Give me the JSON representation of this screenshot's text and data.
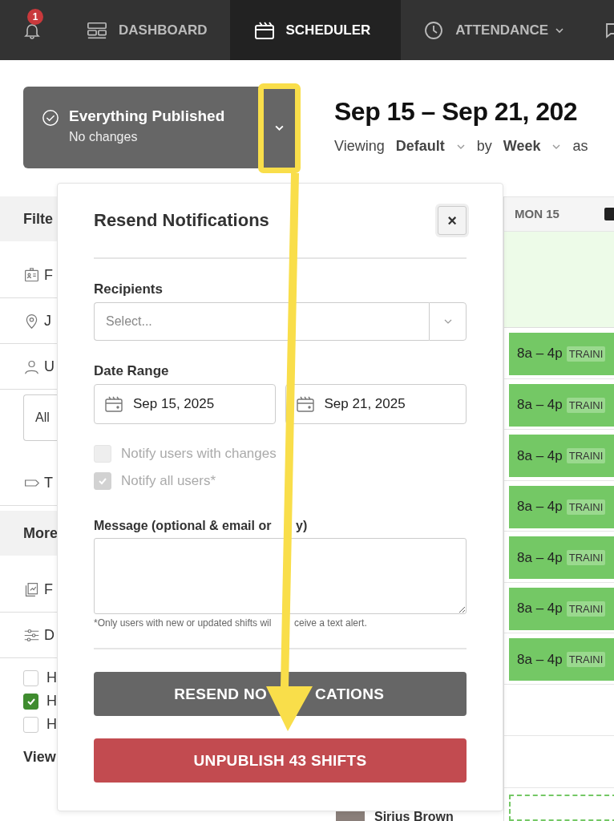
{
  "nav": {
    "badge": "1",
    "tabs": [
      {
        "kind": "dashboard",
        "label": "DASHBOARD",
        "selected": false,
        "dropdown": false
      },
      {
        "kind": "scheduler",
        "label": "SCHEDULER",
        "selected": true,
        "dropdown": false
      },
      {
        "kind": "attendance",
        "label": "ATTENDANCE",
        "selected": false,
        "dropdown": true
      }
    ]
  },
  "publish": {
    "title": "Everything Published",
    "subtitle": "No changes"
  },
  "header": {
    "date_range": "Sep 15 – Sep 21, 202",
    "view_controls": [
      {
        "label": "Viewing",
        "value": "Default"
      },
      {
        "label": "by",
        "value": "Week"
      }
    ],
    "trailing": "as"
  },
  "sidebar": {
    "sections": [
      {
        "title": "Filte",
        "items": [
          {
            "kind": "badge",
            "label": "F"
          },
          {
            "kind": "pin",
            "label": "J"
          },
          {
            "kind": "user",
            "label": "U"
          },
          {
            "kind": "select",
            "label": "All"
          },
          {
            "kind": "tag",
            "label": "T"
          }
        ]
      },
      {
        "title": "More",
        "items": [
          {
            "kind": "report",
            "label": "F"
          },
          {
            "kind": "sliders",
            "label": "D"
          }
        ]
      }
    ],
    "options": [
      {
        "label": "H",
        "checked": false
      },
      {
        "label": "H",
        "checked": true
      },
      {
        "label": "H",
        "checked": false
      }
    ],
    "footer_label": "View"
  },
  "calendar": {
    "day": "MON 15",
    "shifts": [
      {
        "time": "8a – 4p",
        "tag": "TRAINI"
      },
      {
        "time": "8a – 4p",
        "tag": "TRAINI"
      },
      {
        "time": "8a – 4p",
        "tag": "TRAINI"
      },
      {
        "time": "8a – 4p",
        "tag": "TRAINI"
      },
      {
        "time": "8a – 4p",
        "tag": "TRAINI"
      },
      {
        "time": "8a – 4p",
        "tag": "TRAINI"
      },
      {
        "time": "8a – 4p",
        "tag": "TRAINI"
      }
    ]
  },
  "employee": {
    "name": "Sirius Brown"
  },
  "modal": {
    "title": "Resend Notifications",
    "close": "×",
    "recipients_label": "Recipients",
    "recipients_placeholder": "Select...",
    "date_label": "Date Range",
    "date_from": "Sep 15, 2025",
    "date_to": "Sep 21, 2025",
    "checkboxes": [
      {
        "label": "Notify users with changes",
        "checked": false,
        "disabled": true
      },
      {
        "label": "Notify all users*",
        "checked": true,
        "disabled": true
      }
    ],
    "message_label": [
      "Message (optional & email or",
      "y)"
    ],
    "hint": [
      "*Only users with new or updated shifts wil",
      "ceive a text alert."
    ],
    "resend_button": [
      "RESEND NO",
      "CATIONS"
    ],
    "unpublish_button": "UNPUBLISH 43 SHIFTS"
  }
}
